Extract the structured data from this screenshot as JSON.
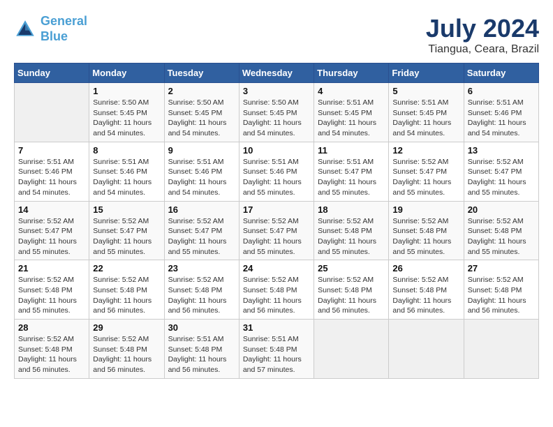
{
  "header": {
    "logo_line1": "General",
    "logo_line2": "Blue",
    "month": "July 2024",
    "location": "Tiangua, Ceara, Brazil"
  },
  "days_of_week": [
    "Sunday",
    "Monday",
    "Tuesday",
    "Wednesday",
    "Thursday",
    "Friday",
    "Saturday"
  ],
  "weeks": [
    [
      {
        "day": "",
        "sunrise": "",
        "sunset": "",
        "daylight": ""
      },
      {
        "day": "1",
        "sunrise": "Sunrise: 5:50 AM",
        "sunset": "Sunset: 5:45 PM",
        "daylight": "Daylight: 11 hours and 54 minutes."
      },
      {
        "day": "2",
        "sunrise": "Sunrise: 5:50 AM",
        "sunset": "Sunset: 5:45 PM",
        "daylight": "Daylight: 11 hours and 54 minutes."
      },
      {
        "day": "3",
        "sunrise": "Sunrise: 5:50 AM",
        "sunset": "Sunset: 5:45 PM",
        "daylight": "Daylight: 11 hours and 54 minutes."
      },
      {
        "day": "4",
        "sunrise": "Sunrise: 5:51 AM",
        "sunset": "Sunset: 5:45 PM",
        "daylight": "Daylight: 11 hours and 54 minutes."
      },
      {
        "day": "5",
        "sunrise": "Sunrise: 5:51 AM",
        "sunset": "Sunset: 5:45 PM",
        "daylight": "Daylight: 11 hours and 54 minutes."
      },
      {
        "day": "6",
        "sunrise": "Sunrise: 5:51 AM",
        "sunset": "Sunset: 5:46 PM",
        "daylight": "Daylight: 11 hours and 54 minutes."
      }
    ],
    [
      {
        "day": "7",
        "sunrise": "Sunrise: 5:51 AM",
        "sunset": "Sunset: 5:46 PM",
        "daylight": "Daylight: 11 hours and 54 minutes."
      },
      {
        "day": "8",
        "sunrise": "Sunrise: 5:51 AM",
        "sunset": "Sunset: 5:46 PM",
        "daylight": "Daylight: 11 hours and 54 minutes."
      },
      {
        "day": "9",
        "sunrise": "Sunrise: 5:51 AM",
        "sunset": "Sunset: 5:46 PM",
        "daylight": "Daylight: 11 hours and 54 minutes."
      },
      {
        "day": "10",
        "sunrise": "Sunrise: 5:51 AM",
        "sunset": "Sunset: 5:46 PM",
        "daylight": "Daylight: 11 hours and 55 minutes."
      },
      {
        "day": "11",
        "sunrise": "Sunrise: 5:51 AM",
        "sunset": "Sunset: 5:47 PM",
        "daylight": "Daylight: 11 hours and 55 minutes."
      },
      {
        "day": "12",
        "sunrise": "Sunrise: 5:52 AM",
        "sunset": "Sunset: 5:47 PM",
        "daylight": "Daylight: 11 hours and 55 minutes."
      },
      {
        "day": "13",
        "sunrise": "Sunrise: 5:52 AM",
        "sunset": "Sunset: 5:47 PM",
        "daylight": "Daylight: 11 hours and 55 minutes."
      }
    ],
    [
      {
        "day": "14",
        "sunrise": "Sunrise: 5:52 AM",
        "sunset": "Sunset: 5:47 PM",
        "daylight": "Daylight: 11 hours and 55 minutes."
      },
      {
        "day": "15",
        "sunrise": "Sunrise: 5:52 AM",
        "sunset": "Sunset: 5:47 PM",
        "daylight": "Daylight: 11 hours and 55 minutes."
      },
      {
        "day": "16",
        "sunrise": "Sunrise: 5:52 AM",
        "sunset": "Sunset: 5:47 PM",
        "daylight": "Daylight: 11 hours and 55 minutes."
      },
      {
        "day": "17",
        "sunrise": "Sunrise: 5:52 AM",
        "sunset": "Sunset: 5:47 PM",
        "daylight": "Daylight: 11 hours and 55 minutes."
      },
      {
        "day": "18",
        "sunrise": "Sunrise: 5:52 AM",
        "sunset": "Sunset: 5:48 PM",
        "daylight": "Daylight: 11 hours and 55 minutes."
      },
      {
        "day": "19",
        "sunrise": "Sunrise: 5:52 AM",
        "sunset": "Sunset: 5:48 PM",
        "daylight": "Daylight: 11 hours and 55 minutes."
      },
      {
        "day": "20",
        "sunrise": "Sunrise: 5:52 AM",
        "sunset": "Sunset: 5:48 PM",
        "daylight": "Daylight: 11 hours and 55 minutes."
      }
    ],
    [
      {
        "day": "21",
        "sunrise": "Sunrise: 5:52 AM",
        "sunset": "Sunset: 5:48 PM",
        "daylight": "Daylight: 11 hours and 55 minutes."
      },
      {
        "day": "22",
        "sunrise": "Sunrise: 5:52 AM",
        "sunset": "Sunset: 5:48 PM",
        "daylight": "Daylight: 11 hours and 56 minutes."
      },
      {
        "day": "23",
        "sunrise": "Sunrise: 5:52 AM",
        "sunset": "Sunset: 5:48 PM",
        "daylight": "Daylight: 11 hours and 56 minutes."
      },
      {
        "day": "24",
        "sunrise": "Sunrise: 5:52 AM",
        "sunset": "Sunset: 5:48 PM",
        "daylight": "Daylight: 11 hours and 56 minutes."
      },
      {
        "day": "25",
        "sunrise": "Sunrise: 5:52 AM",
        "sunset": "Sunset: 5:48 PM",
        "daylight": "Daylight: 11 hours and 56 minutes."
      },
      {
        "day": "26",
        "sunrise": "Sunrise: 5:52 AM",
        "sunset": "Sunset: 5:48 PM",
        "daylight": "Daylight: 11 hours and 56 minutes."
      },
      {
        "day": "27",
        "sunrise": "Sunrise: 5:52 AM",
        "sunset": "Sunset: 5:48 PM",
        "daylight": "Daylight: 11 hours and 56 minutes."
      }
    ],
    [
      {
        "day": "28",
        "sunrise": "Sunrise: 5:52 AM",
        "sunset": "Sunset: 5:48 PM",
        "daylight": "Daylight: 11 hours and 56 minutes."
      },
      {
        "day": "29",
        "sunrise": "Sunrise: 5:52 AM",
        "sunset": "Sunset: 5:48 PM",
        "daylight": "Daylight: 11 hours and 56 minutes."
      },
      {
        "day": "30",
        "sunrise": "Sunrise: 5:51 AM",
        "sunset": "Sunset: 5:48 PM",
        "daylight": "Daylight: 11 hours and 56 minutes."
      },
      {
        "day": "31",
        "sunrise": "Sunrise: 5:51 AM",
        "sunset": "Sunset: 5:48 PM",
        "daylight": "Daylight: 11 hours and 57 minutes."
      },
      {
        "day": "",
        "sunrise": "",
        "sunset": "",
        "daylight": ""
      },
      {
        "day": "",
        "sunrise": "",
        "sunset": "",
        "daylight": ""
      },
      {
        "day": "",
        "sunrise": "",
        "sunset": "",
        "daylight": ""
      }
    ]
  ]
}
